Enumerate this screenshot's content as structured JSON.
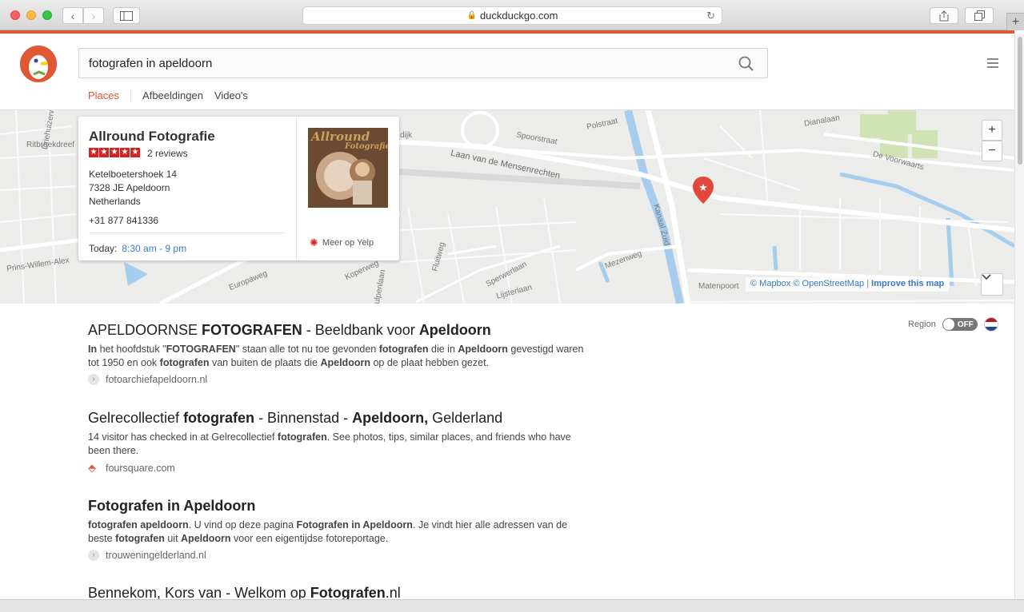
{
  "browser": {
    "url": "duckduckgo.com",
    "new_tab_label": "+"
  },
  "search": {
    "query": "fotografen in apeldoorn"
  },
  "tabs": [
    {
      "label": "Places",
      "active": true
    },
    {
      "label": "Afbeeldingen",
      "active": false
    },
    {
      "label": "Video's",
      "active": false
    }
  ],
  "map": {
    "labels": {
      "driehuizerweg": "Driehuizerweg",
      "ritbroekdreef": "Ritbroekdreef",
      "prins": "Prins-Willem-Alex",
      "dijk": "dijk",
      "spoorstraat": "Spoorstraat",
      "polstraat": "Polstraat",
      "laan": "Laan van de Mensenrechten",
      "dianalaan": "Dianalaan",
      "voorwaarts": "De Voorwaarts",
      "kanaal": "Kanaal Zuid",
      "mezenweg": "Mezenweg",
      "sperwerlaan": "Sperwerlaan",
      "lijsterlaan": "Lijsterlaan",
      "fluitweg": "Fluitweg",
      "europaweg": "Europaweg",
      "koperweg": "Koperweg",
      "wulpenlaan": "Wulpenlaan",
      "matenpoort": "Matenpoort"
    },
    "zoom_in": "+",
    "zoom_out": "−",
    "attribution": {
      "mapbox": "© Mapbox",
      "osm": "© OpenStreetMap",
      "sep": "|",
      "improve": "Improve this map"
    },
    "expand_icon": "chevron-down-icon"
  },
  "place": {
    "name": "Allround Fotografie",
    "reviews": "2 reviews",
    "rating_stars": 5,
    "address_line1": "Ketelboetershoek 14",
    "address_line2": "7328 JE Apeldoorn",
    "address_line3": "Netherlands",
    "phone": "+31 877 841336",
    "today_label": "Today:",
    "hours": "8:30 am - 9 pm",
    "thumb_text": "Allround",
    "thumb_subtext": "Fotografie",
    "yelp_link": "Meer op Yelp"
  },
  "region": {
    "label": "Region",
    "toggle": "OFF"
  },
  "results": [
    {
      "title_html": "APELDOORNSE <b>FOTOGRAFEN</b> - Beeldbank voor <b>Apeldoorn</b>",
      "snippet_html": "<b>In</b> het hoofdstuk \"<b>FOTOGRAFEN</b>\" staan alle tot nu toe gevonden <b>fotografen</b> die in <b>Apeldoorn</b> gevestigd waren tot 1950 en ook <b>fotografen</b> van buiten de plaats die <b>Apeldoorn</b> op de plaat hebben gezet.",
      "url": "fotoarchiefapeldoorn.nl"
    },
    {
      "title_html": "Gelrecollectief <b>fotografen</b> - Binnenstad - <b>Apeldoorn,</b> Gelderland",
      "snippet_html": "14 visitor has checked in at Gelrecollectief <b>fotografen</b>. See photos, tips, similar places, and friends who have been there.",
      "url": "foursquare.com"
    },
    {
      "title_html": "<b>Fotografen in Apeldoorn</b>",
      "snippet_html": "<b>fotografen apeldoorn</b>. U vind op deze pagina <b>Fotografen in Apeldoorn</b>. Je vindt hier alle adressen van de beste <b>fotografen</b> uit <b>Apeldoorn</b> voor een eigentijdse fotoreportage.",
      "url": "trouweningelderland.nl"
    },
    {
      "title_html": "Bennekom, Kors van - Welkom op <b>Fotografen</b>.nl",
      "snippet_html": "",
      "url": ""
    }
  ],
  "colors": {
    "brand": "#de5833",
    "link": "#3b7bbf",
    "yelp": "#d32323"
  }
}
